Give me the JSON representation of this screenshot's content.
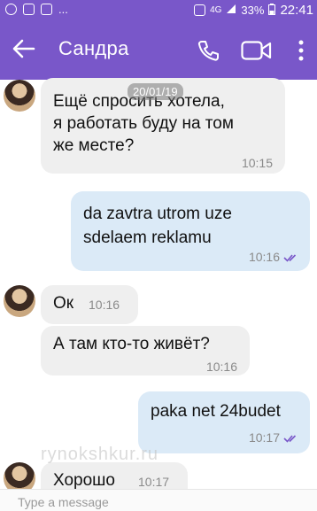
{
  "statusbar": {
    "battery": "33%",
    "time": "22:41",
    "network": "4G",
    "more": "..."
  },
  "header": {
    "contact_name": "Сандра"
  },
  "conversation": {
    "date_label": "20/01/19",
    "messages": [
      {
        "direction": "in",
        "text_lines": [
          "Ещё спросить хотела,",
          "я работать буду на том",
          "же месте?"
        ],
        "time": "10:15"
      },
      {
        "direction": "out",
        "text_lines": [
          "da zavtra utrom uze",
          "sdelaem reklamu"
        ],
        "time": "10:16"
      },
      {
        "direction": "in",
        "text_lines": [
          "Ок"
        ],
        "time": "10:16"
      },
      {
        "direction": "in",
        "text_lines": [
          "А там кто-то живёт?"
        ],
        "time": "10:16"
      },
      {
        "direction": "out",
        "text_lines": [
          "paka net 24budet"
        ],
        "time": "10:17"
      },
      {
        "direction": "in",
        "text_lines": [
          "Хорошо"
        ],
        "time": "10:17"
      }
    ]
  },
  "watermark": "rynokshkur.ru",
  "composer": {
    "placeholder": "Type a message"
  },
  "colors": {
    "brand": "#7957c9",
    "incoming_bubble": "#efefef",
    "outgoing_bubble": "#dbeaf7",
    "read_ticks": "#7957c9"
  }
}
